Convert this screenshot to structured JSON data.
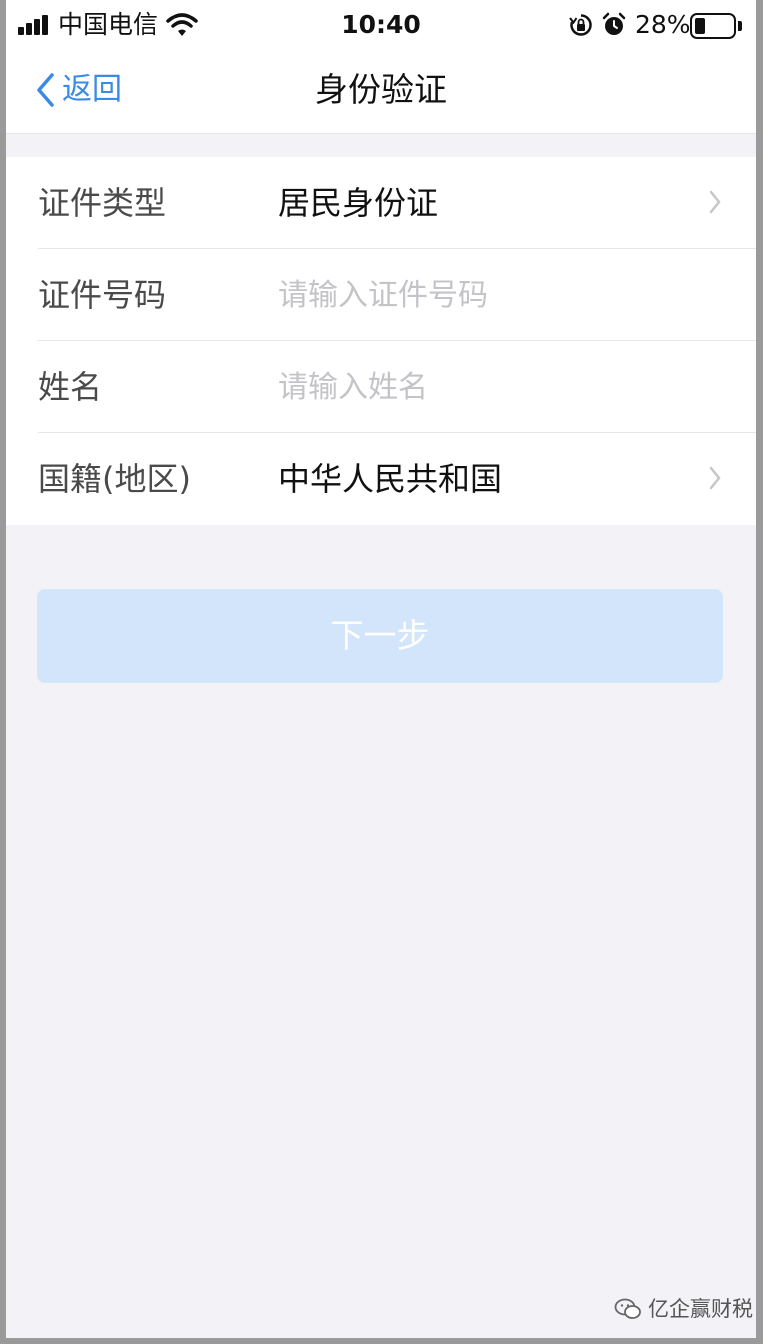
{
  "status_bar": {
    "carrier": "中国电信",
    "time": "10:40",
    "battery_percent": "28%",
    "battery_level": 0.28,
    "icons": [
      "signal-icon",
      "wifi-icon",
      "orientation-lock-icon",
      "alarm-icon",
      "battery-icon"
    ]
  },
  "nav": {
    "back_label": "返回",
    "title": "身份验证"
  },
  "form": {
    "rows": [
      {
        "label": "证件类型",
        "value": "居民身份证",
        "kind": "select"
      },
      {
        "label": "证件号码",
        "placeholder": "请输入证件号码",
        "kind": "input"
      },
      {
        "label": "姓名",
        "placeholder": "请输入姓名",
        "kind": "input"
      },
      {
        "label": "国籍(地区)",
        "value": "中华人民共和国",
        "kind": "select"
      }
    ]
  },
  "next_button": {
    "label": "下一步",
    "enabled": false
  },
  "watermark": {
    "text": "亿企赢财税"
  },
  "colors": {
    "accent": "#3a8be6",
    "button_disabled": "#d3e5fa",
    "page_bg": "#f3f3f7",
    "placeholder": "#c4c4c8"
  }
}
